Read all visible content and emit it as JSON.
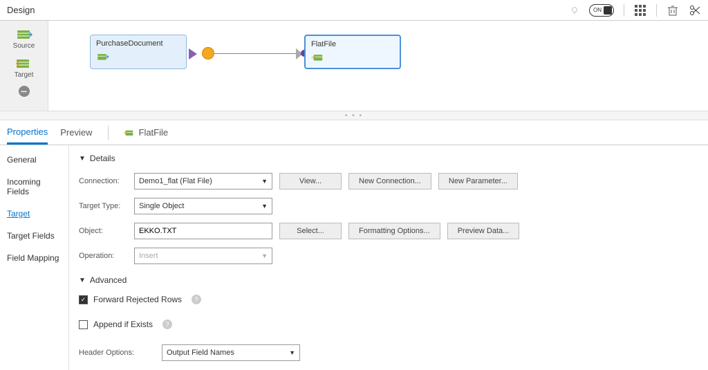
{
  "topbar": {
    "title": "Design",
    "toggle_label": "ON"
  },
  "palette": {
    "source_label": "Source",
    "target_label": "Target"
  },
  "canvas": {
    "source_node": "PurchaseDocument",
    "target_node": "FlatFile"
  },
  "tabs": {
    "properties": "Properties",
    "preview": "Preview",
    "context": "FlatFile"
  },
  "sidenav": {
    "general": "General",
    "incoming": "Incoming Fields",
    "target": "Target",
    "target_fields": "Target Fields",
    "field_mapping": "Field Mapping"
  },
  "sections": {
    "details": "Details",
    "advanced": "Advanced"
  },
  "details": {
    "connection_label": "Connection:",
    "connection_value": "Demo1_flat (Flat File)",
    "view_btn": "View...",
    "new_conn_btn": "New Connection...",
    "new_param_btn": "New Parameter...",
    "target_type_label": "Target Type:",
    "target_type_value": "Single Object",
    "object_label": "Object:",
    "object_value": "EKKO.TXT",
    "select_btn": "Select...",
    "format_btn": "Formatting Options...",
    "preview_btn": "Preview Data...",
    "operation_label": "Operation:",
    "operation_value": "Insert"
  },
  "advanced": {
    "forward_label": "Forward Rejected Rows",
    "append_label": "Append if Exists",
    "header_label": "Header Options:",
    "header_value": "Output Field Names"
  }
}
